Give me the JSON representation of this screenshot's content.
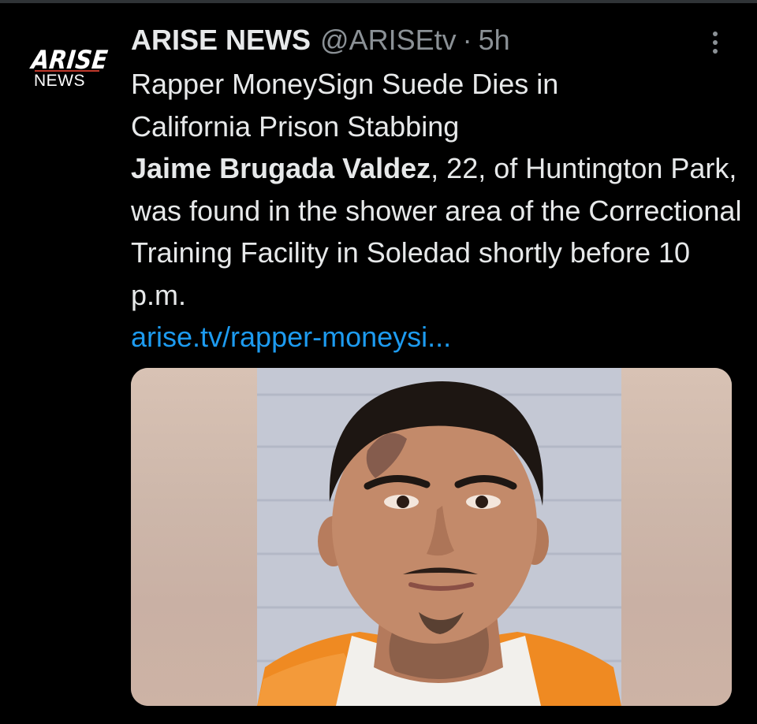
{
  "account": {
    "logo_line1": "ARISE",
    "logo_line2": "NEWS",
    "display_name": "ARISE NEWS",
    "handle": "@ARISEtv",
    "separator": "·",
    "time": "5h"
  },
  "tweet": {
    "headline_line1": "Rapper MoneySign Suede Dies in",
    "headline_line2": "California Prison Stabbing",
    "bold_name": "Jaime Brugada Valdez",
    "body_rest": ", 22, of Huntington Park, was found in the shower area of the Correctional Training Facility in Soledad shortly before 10 p.m.",
    "link_text": "arise.tv/rapper-moneysi..."
  },
  "icons": {
    "more": "more-options-icon"
  },
  "colors": {
    "background": "#000000",
    "text": "#e7e9ea",
    "muted": "#8b9196",
    "link": "#1d9bf0",
    "uniform": "#f28a1e"
  }
}
